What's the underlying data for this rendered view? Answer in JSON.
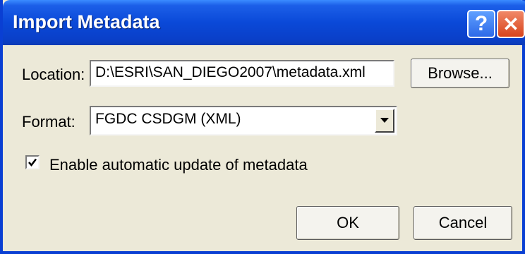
{
  "window": {
    "title": "Import Metadata",
    "help_glyph": "?",
    "close_glyph": "✕"
  },
  "location": {
    "label": "Location:",
    "value": "D:\\ESRI\\SAN_DIEGO2007\\metadata.xml",
    "browse_label": "Browse..."
  },
  "format": {
    "label": "Format:",
    "selected": "FGDC CSDGM (XML)"
  },
  "auto_update": {
    "label": "Enable automatic update of metadata",
    "checked": true
  },
  "buttons": {
    "ok": "OK",
    "cancel": "Cancel"
  },
  "colors": {
    "titlebar": "#0a49d8",
    "dialog_face": "#ece9d8",
    "close_button": "#d8441c"
  },
  "icons": {
    "help": "help-icon",
    "close": "close-icon",
    "dropdown": "chevron-down-icon",
    "check": "checkmark-icon"
  }
}
